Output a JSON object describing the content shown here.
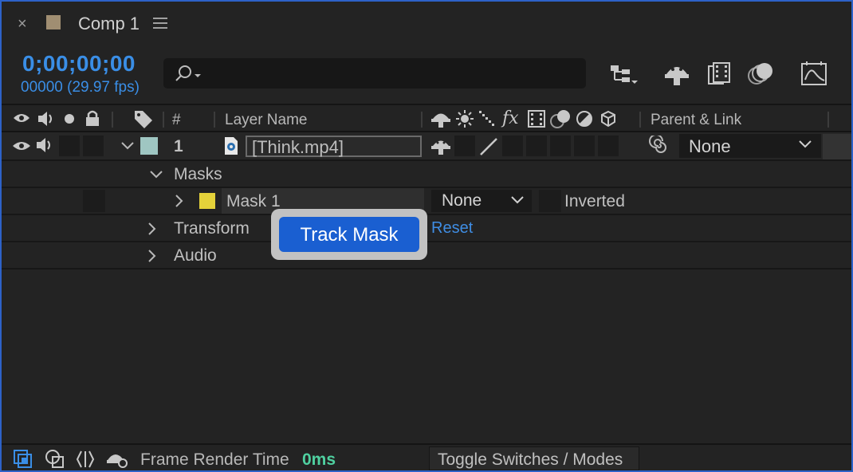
{
  "panel": {
    "close_glyph": "×",
    "comp_label_color": "#a08e72",
    "title": "Comp 1",
    "menu_icon": "hamburger-icon"
  },
  "time": {
    "timecode": "0;00;00;00",
    "frames": "00000 (29.97 fps)",
    "accent": "#3a8ee6"
  },
  "search": {
    "value": "",
    "icon": "search-icon"
  },
  "toolbar": {
    "icons": [
      "composition-flowchart-icon",
      "draft-3d-icon",
      "frame-blending-icon",
      "motion-blur-icon",
      "graph-editor-icon"
    ]
  },
  "header": {
    "number": "#",
    "layer_name": "Layer Name",
    "parent_link": "Parent & Link",
    "fx": "fx"
  },
  "layer": {
    "index": "1",
    "label_color": "#9fc6c2",
    "name": "[Think.mp4]",
    "parent": "None"
  },
  "properties": {
    "masks": "Masks",
    "mask1": {
      "name": "Mask 1",
      "color": "#e4d23a",
      "mode": "None",
      "inverted_label": "Inverted"
    },
    "transform": "Transform",
    "transform_reset": "Reset",
    "audio": "Audio"
  },
  "tooltip": {
    "text": "Track Mask"
  },
  "bottom": {
    "frame_render_label": "Frame Render Time",
    "frame_render_value": "0ms",
    "toggle_label": "Toggle Switches / Modes"
  }
}
